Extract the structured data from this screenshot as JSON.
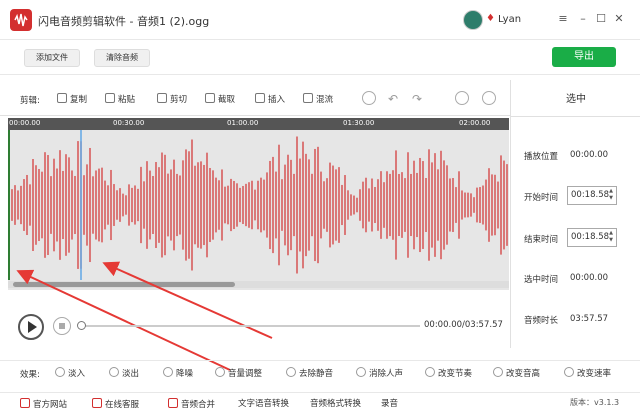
{
  "app": {
    "title": "闪电音频剪辑软件 - 音频1 (2).ogg",
    "user_name": "Lyan",
    "accent": "#1aad47",
    "brand": "#d32f2f"
  },
  "toolbar": {
    "add_file": "添加文件",
    "clear_audio": "清除音频",
    "export": "导出"
  },
  "edit": {
    "label": "剪辑:",
    "tools": [
      "复制",
      "粘贴",
      "剪切",
      "截取",
      "插入",
      "混流"
    ]
  },
  "timeline": {
    "ticks": [
      "00:00.00",
      "00:30.00",
      "01:00.00",
      "01:30.00",
      "02:00.00"
    ]
  },
  "panel": {
    "title": "选中",
    "play_position_label": "播放位置",
    "play_position_value": "00:00.00",
    "start_label": "开始时间",
    "start_value": "00:18.58",
    "end_label": "结束时间",
    "end_value": "00:18.58",
    "selected_label": "选中时间",
    "selected_value": "00:00.00",
    "duration_label": "音频时长",
    "duration_value": "03:57.57"
  },
  "player": {
    "time": "00:00.00/03:57.57",
    "progress": 0
  },
  "effects": {
    "label": "效果:",
    "items": [
      "淡入",
      "淡出",
      "降噪",
      "音量调整",
      "去除静音",
      "消除人声",
      "改变节奏",
      "改变音高",
      "改变速率"
    ]
  },
  "footer": {
    "items": [
      "官方网站",
      "在线客服",
      "音频合并",
      "文字语音转换",
      "音频格式转换",
      "录音"
    ],
    "version": "版本：v3.1.3"
  }
}
